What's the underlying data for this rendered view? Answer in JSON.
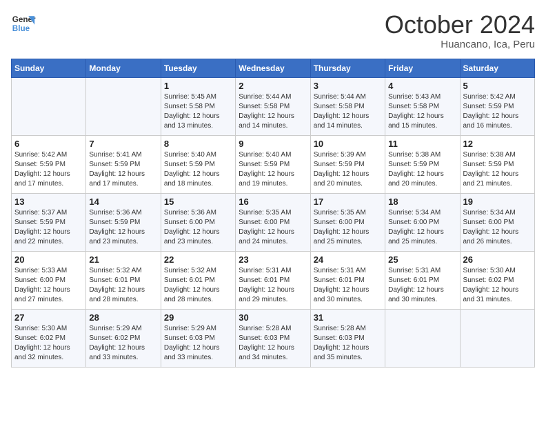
{
  "header": {
    "logo_general": "General",
    "logo_blue": "Blue",
    "month_title": "October 2024",
    "location": "Huancano, Ica, Peru"
  },
  "days_of_week": [
    "Sunday",
    "Monday",
    "Tuesday",
    "Wednesday",
    "Thursday",
    "Friday",
    "Saturday"
  ],
  "weeks": [
    [
      {
        "day": "",
        "info": ""
      },
      {
        "day": "",
        "info": ""
      },
      {
        "day": "1",
        "info": "Sunrise: 5:45 AM\nSunset: 5:58 PM\nDaylight: 12 hours and 13 minutes."
      },
      {
        "day": "2",
        "info": "Sunrise: 5:44 AM\nSunset: 5:58 PM\nDaylight: 12 hours and 14 minutes."
      },
      {
        "day": "3",
        "info": "Sunrise: 5:44 AM\nSunset: 5:58 PM\nDaylight: 12 hours and 14 minutes."
      },
      {
        "day": "4",
        "info": "Sunrise: 5:43 AM\nSunset: 5:58 PM\nDaylight: 12 hours and 15 minutes."
      },
      {
        "day": "5",
        "info": "Sunrise: 5:42 AM\nSunset: 5:59 PM\nDaylight: 12 hours and 16 minutes."
      }
    ],
    [
      {
        "day": "6",
        "info": "Sunrise: 5:42 AM\nSunset: 5:59 PM\nDaylight: 12 hours and 17 minutes."
      },
      {
        "day": "7",
        "info": "Sunrise: 5:41 AM\nSunset: 5:59 PM\nDaylight: 12 hours and 17 minutes."
      },
      {
        "day": "8",
        "info": "Sunrise: 5:40 AM\nSunset: 5:59 PM\nDaylight: 12 hours and 18 minutes."
      },
      {
        "day": "9",
        "info": "Sunrise: 5:40 AM\nSunset: 5:59 PM\nDaylight: 12 hours and 19 minutes."
      },
      {
        "day": "10",
        "info": "Sunrise: 5:39 AM\nSunset: 5:59 PM\nDaylight: 12 hours and 20 minutes."
      },
      {
        "day": "11",
        "info": "Sunrise: 5:38 AM\nSunset: 5:59 PM\nDaylight: 12 hours and 20 minutes."
      },
      {
        "day": "12",
        "info": "Sunrise: 5:38 AM\nSunset: 5:59 PM\nDaylight: 12 hours and 21 minutes."
      }
    ],
    [
      {
        "day": "13",
        "info": "Sunrise: 5:37 AM\nSunset: 5:59 PM\nDaylight: 12 hours and 22 minutes."
      },
      {
        "day": "14",
        "info": "Sunrise: 5:36 AM\nSunset: 5:59 PM\nDaylight: 12 hours and 23 minutes."
      },
      {
        "day": "15",
        "info": "Sunrise: 5:36 AM\nSunset: 6:00 PM\nDaylight: 12 hours and 23 minutes."
      },
      {
        "day": "16",
        "info": "Sunrise: 5:35 AM\nSunset: 6:00 PM\nDaylight: 12 hours and 24 minutes."
      },
      {
        "day": "17",
        "info": "Sunrise: 5:35 AM\nSunset: 6:00 PM\nDaylight: 12 hours and 25 minutes."
      },
      {
        "day": "18",
        "info": "Sunrise: 5:34 AM\nSunset: 6:00 PM\nDaylight: 12 hours and 25 minutes."
      },
      {
        "day": "19",
        "info": "Sunrise: 5:34 AM\nSunset: 6:00 PM\nDaylight: 12 hours and 26 minutes."
      }
    ],
    [
      {
        "day": "20",
        "info": "Sunrise: 5:33 AM\nSunset: 6:00 PM\nDaylight: 12 hours and 27 minutes."
      },
      {
        "day": "21",
        "info": "Sunrise: 5:32 AM\nSunset: 6:01 PM\nDaylight: 12 hours and 28 minutes."
      },
      {
        "day": "22",
        "info": "Sunrise: 5:32 AM\nSunset: 6:01 PM\nDaylight: 12 hours and 28 minutes."
      },
      {
        "day": "23",
        "info": "Sunrise: 5:31 AM\nSunset: 6:01 PM\nDaylight: 12 hours and 29 minutes."
      },
      {
        "day": "24",
        "info": "Sunrise: 5:31 AM\nSunset: 6:01 PM\nDaylight: 12 hours and 30 minutes."
      },
      {
        "day": "25",
        "info": "Sunrise: 5:31 AM\nSunset: 6:01 PM\nDaylight: 12 hours and 30 minutes."
      },
      {
        "day": "26",
        "info": "Sunrise: 5:30 AM\nSunset: 6:02 PM\nDaylight: 12 hours and 31 minutes."
      }
    ],
    [
      {
        "day": "27",
        "info": "Sunrise: 5:30 AM\nSunset: 6:02 PM\nDaylight: 12 hours and 32 minutes."
      },
      {
        "day": "28",
        "info": "Sunrise: 5:29 AM\nSunset: 6:02 PM\nDaylight: 12 hours and 33 minutes."
      },
      {
        "day": "29",
        "info": "Sunrise: 5:29 AM\nSunset: 6:03 PM\nDaylight: 12 hours and 33 minutes."
      },
      {
        "day": "30",
        "info": "Sunrise: 5:28 AM\nSunset: 6:03 PM\nDaylight: 12 hours and 34 minutes."
      },
      {
        "day": "31",
        "info": "Sunrise: 5:28 AM\nSunset: 6:03 PM\nDaylight: 12 hours and 35 minutes."
      },
      {
        "day": "",
        "info": ""
      },
      {
        "day": "",
        "info": ""
      }
    ]
  ]
}
